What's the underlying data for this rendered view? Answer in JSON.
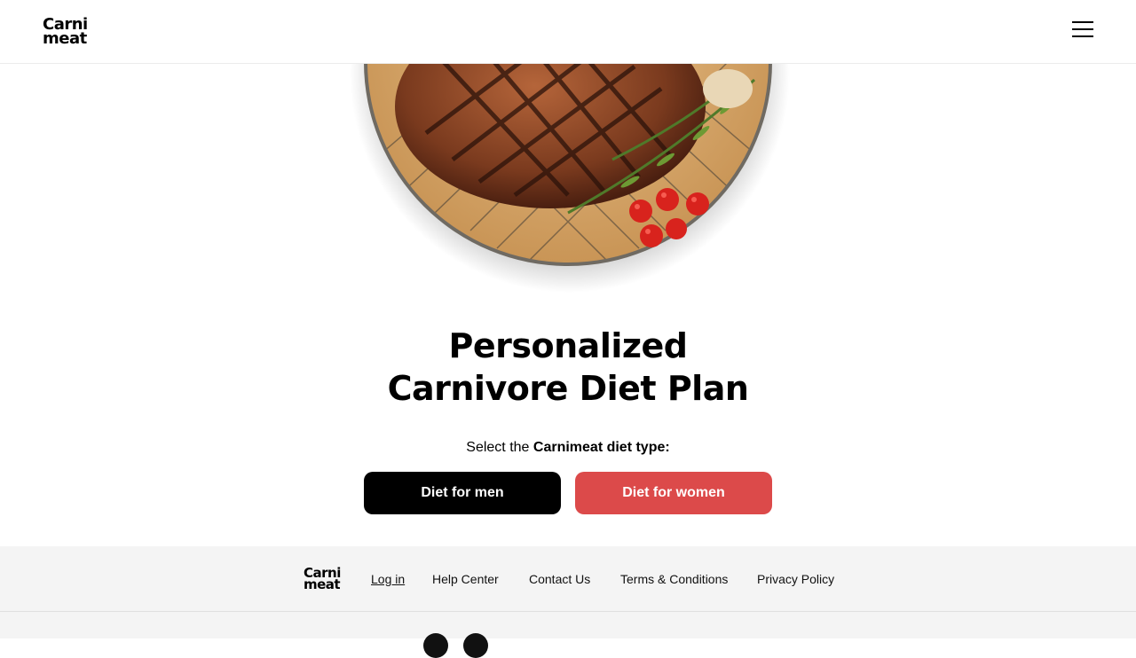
{
  "header": {
    "logo_line1": "Carni",
    "logo_line2": "meat",
    "menu_icon": "hamburger-menu-icon"
  },
  "hero": {
    "image_subject": "grilled-steak-on-plate"
  },
  "main": {
    "title_line1": "Personalized",
    "title_line2": "Carnivore Diet Plan",
    "subtitle_prefix": "Select the ",
    "subtitle_bold": "Carnimeat diet type:",
    "button_men": "Diet for men",
    "button_women": "Diet for women"
  },
  "colors": {
    "men_button": "#000000",
    "women_button": "#dc4a4a",
    "footer_bg": "#f4f4f4"
  },
  "footer": {
    "logo_line1": "Carni",
    "logo_line2": "meat",
    "links": [
      "Log in",
      "Help Center",
      "Contact Us",
      "Terms & Conditions",
      "Privacy Policy"
    ],
    "social_icons": [
      "social-icon",
      "social-icon"
    ]
  }
}
